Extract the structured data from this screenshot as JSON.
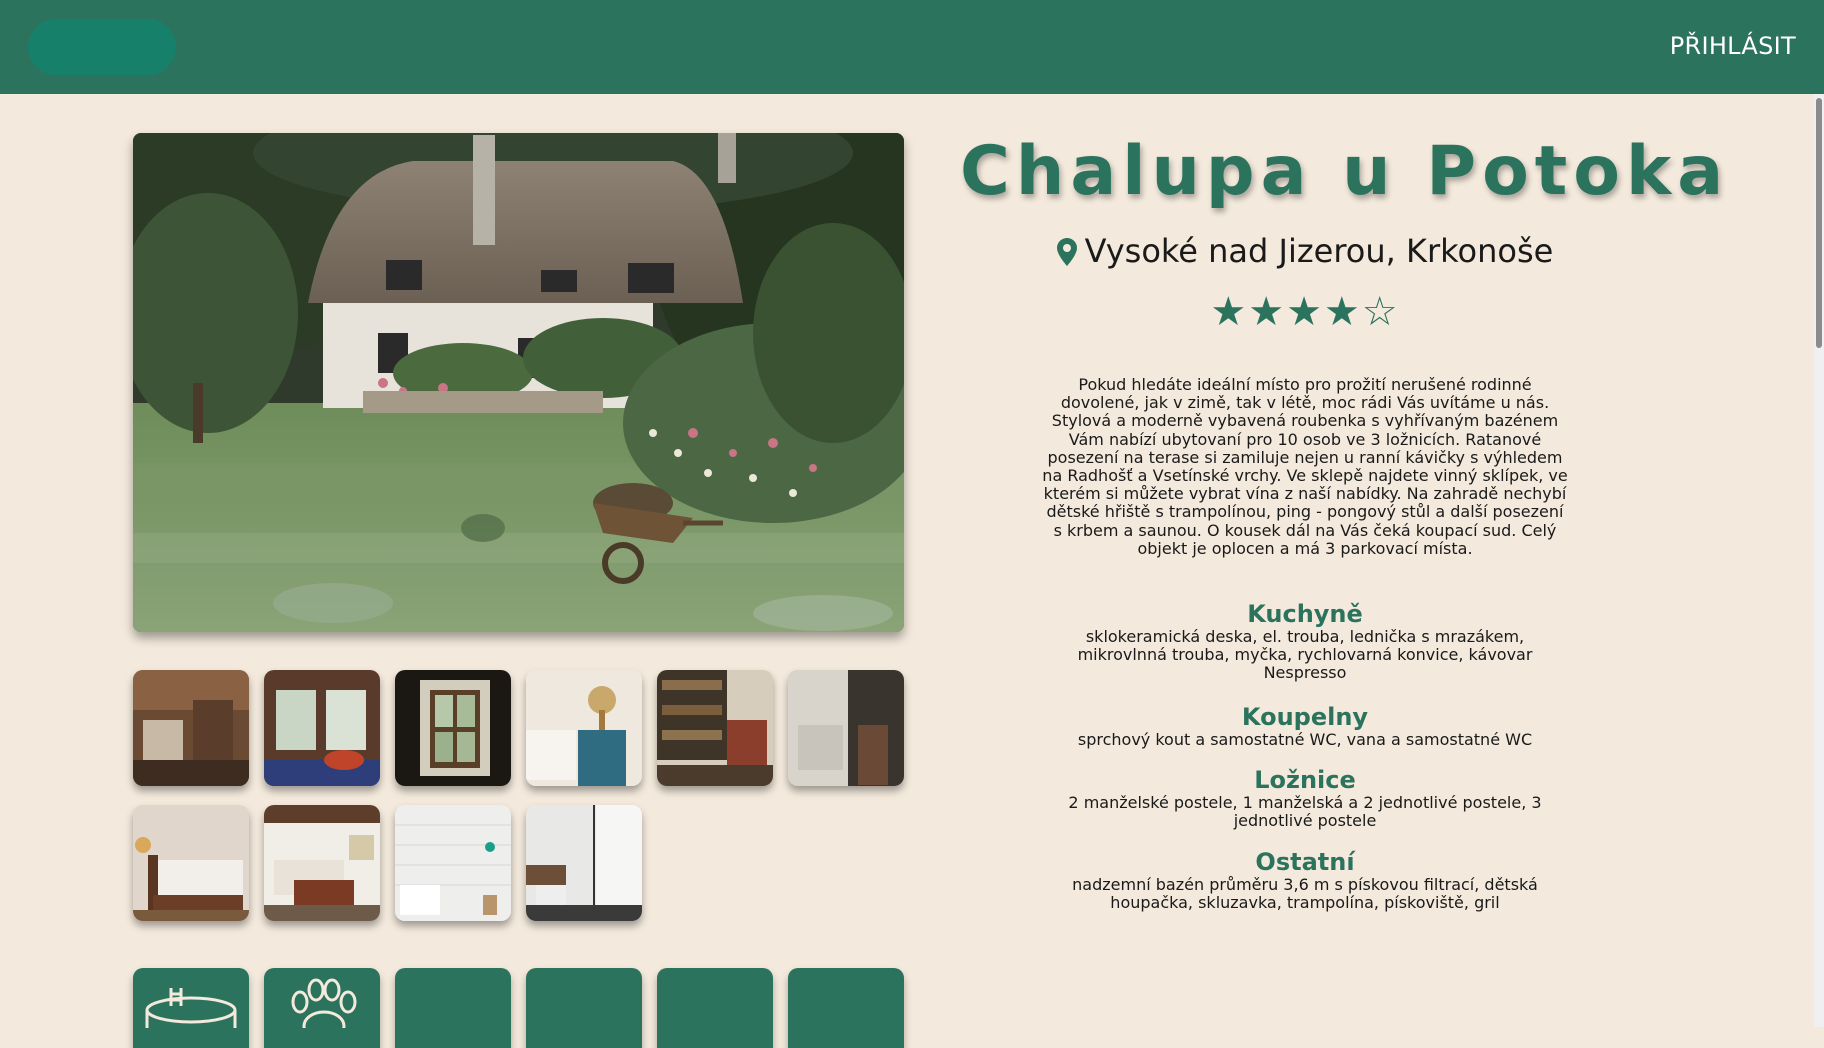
{
  "header": {
    "login_label": "PŘIHLÁSIT"
  },
  "listing": {
    "title": "Chalupa u Potoka",
    "location": "Vysoké nad Jizerou, Krkonoše",
    "rating": 4,
    "rating_max": 5,
    "stars_text": "★★★★☆",
    "description": "Pokud hledáte ideální místo pro prožití nerušené rodinné dovolené, jak v zimě, tak v létě, moc rádi Vás uvítáme u nás. Stylová a moderně vybavená roubenka s vyhřívaným bazénem Vám nabízí ubytovaní pro 10 osob ve 3 ložnicích. Ratanové posezení na terase si zamiluje nejen u ranní kávičky s výhledem na Radhošť a Vsetínské vrchy. Ve sklepě najdete vinný sklípek, ve kterém si můžete vybrat vína z naší nabídky. Na zahradě nechybí dětské hřiště s trampolínou, ping - pongový stůl a další posezení s krbem a saunou. O kousek dál na Vás čeká koupací sud. Celý objekt je oplocen a má 3 parkovací místa."
  },
  "sections": [
    {
      "title": "Kuchyně",
      "text": "sklokeramická deska, el. trouba, lednička s mrazákem, mikrovlnná trouba, myčka, rychlovarná konvice, kávovar Nespresso"
    },
    {
      "title": "Koupelny",
      "text": "sprchový kout a samostatné WC, vana a samostatné WC"
    },
    {
      "title": "Ložnice",
      "text": "2 manželské postele, 1 manželská a 2 jednotlivé postele, 3 jednotlivé postele"
    },
    {
      "title": "Ostatní",
      "text": "nadzemní bazén průměru 3,6 m s pískovou filtrací, dětská houpačka, skluzavka, trampolína, pískoviště, gril"
    }
  ],
  "colors": {
    "brand": "#2c735e",
    "background": "#f3e9dc",
    "logo": "#17806a"
  },
  "icons": {
    "location": "map-pin-icon",
    "amenity_1": "pool-icon",
    "amenity_2": "paw-icon"
  }
}
